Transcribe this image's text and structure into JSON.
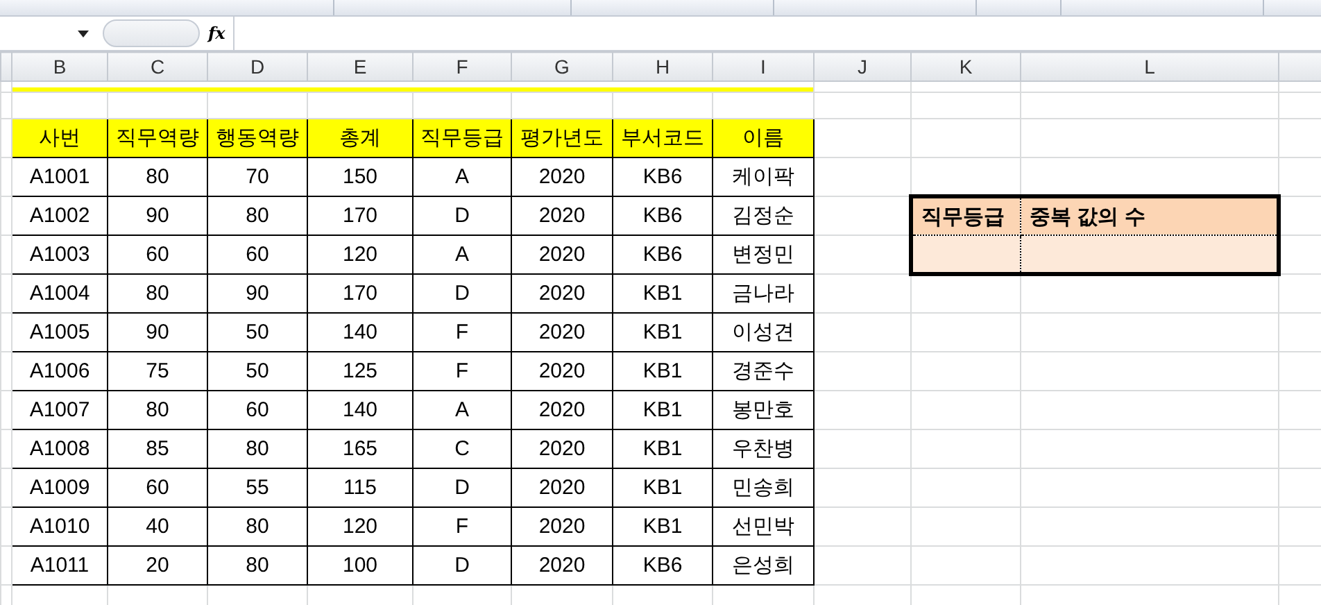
{
  "formula_bar": {
    "fx": "fx"
  },
  "column_headers": [
    "B",
    "C",
    "D",
    "E",
    "F",
    "G",
    "H",
    "I",
    "J",
    "K",
    "L"
  ],
  "table": {
    "columns": [
      "사번",
      "직무역량",
      "행동역량",
      "총계",
      "직무등급",
      "평가년도",
      "부서코드",
      "이름"
    ],
    "rows": [
      [
        "A1001",
        "80",
        "70",
        "150",
        "A",
        "2020",
        "KB6",
        "케이팍"
      ],
      [
        "A1002",
        "90",
        "80",
        "170",
        "D",
        "2020",
        "KB6",
        "김정순"
      ],
      [
        "A1003",
        "60",
        "60",
        "120",
        "A",
        "2020",
        "KB6",
        "변정민"
      ],
      [
        "A1004",
        "80",
        "90",
        "170",
        "D",
        "2020",
        "KB1",
        "금나라"
      ],
      [
        "A1005",
        "90",
        "50",
        "140",
        "F",
        "2020",
        "KB1",
        "이성견"
      ],
      [
        "A1006",
        "75",
        "50",
        "125",
        "F",
        "2020",
        "KB1",
        "경준수"
      ],
      [
        "A1007",
        "80",
        "60",
        "140",
        "A",
        "2020",
        "KB1",
        "봉만호"
      ],
      [
        "A1008",
        "85",
        "80",
        "165",
        "C",
        "2020",
        "KB1",
        "우찬병"
      ],
      [
        "A1009",
        "60",
        "55",
        "115",
        "D",
        "2020",
        "KB1",
        "민송희"
      ],
      [
        "A1010",
        "40",
        "80",
        "120",
        "F",
        "2020",
        "KB1",
        "선민박"
      ],
      [
        "A1011",
        "20",
        "80",
        "100",
        "D",
        "2020",
        "KB6",
        "은성희"
      ]
    ]
  },
  "summary_table": {
    "columns": [
      "직무등급",
      "중복 값의 수"
    ]
  }
}
